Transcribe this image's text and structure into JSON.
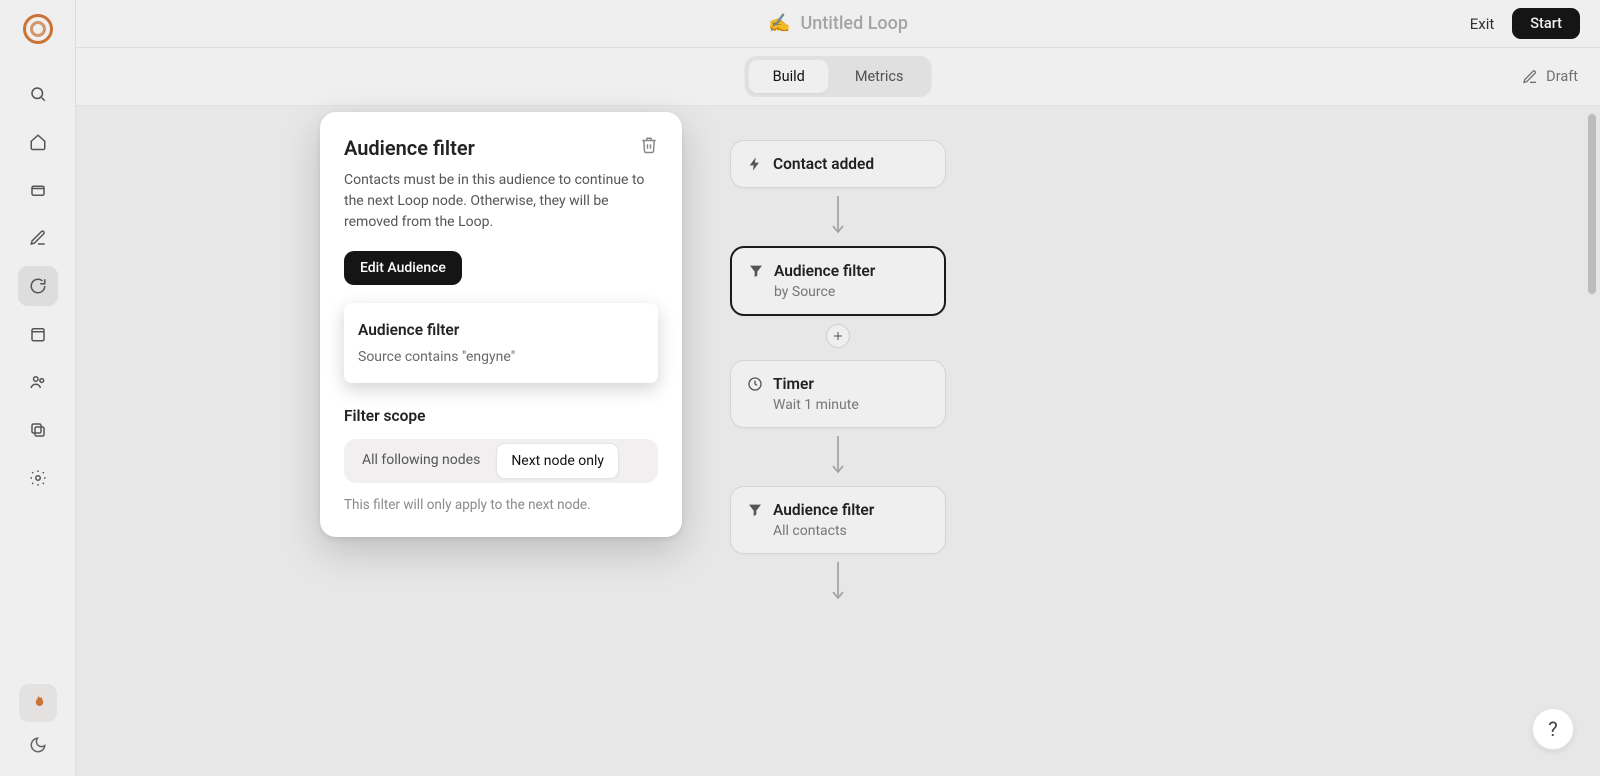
{
  "header": {
    "emoji": "✍️",
    "title": "Untitled Loop",
    "exit_label": "Exit",
    "start_label": "Start"
  },
  "tabs": {
    "build": "Build",
    "metrics": "Metrics"
  },
  "status": {
    "label": "Draft"
  },
  "flow": {
    "node1": {
      "title": "Contact added"
    },
    "node2": {
      "title": "Audience filter",
      "subtitle": "by Source"
    },
    "node3": {
      "title": "Timer",
      "subtitle": "Wait 1 minute"
    },
    "node4": {
      "title": "Audience filter",
      "subtitle": "All contacts"
    }
  },
  "panel": {
    "title": "Audience filter",
    "description": "Contacts must be in this audience to continue to the next Loop node. Otherwise, they will be removed from the Loop.",
    "edit_label": "Edit Audience",
    "highlight_title": "Audience filter",
    "highlight_sub": "Source contains \"engyne\"",
    "scope_title": "Filter scope",
    "scope_all": "All following nodes",
    "scope_next": "Next node only",
    "scope_hint": "This filter will only apply to the next node."
  },
  "help": {
    "label": "?"
  }
}
